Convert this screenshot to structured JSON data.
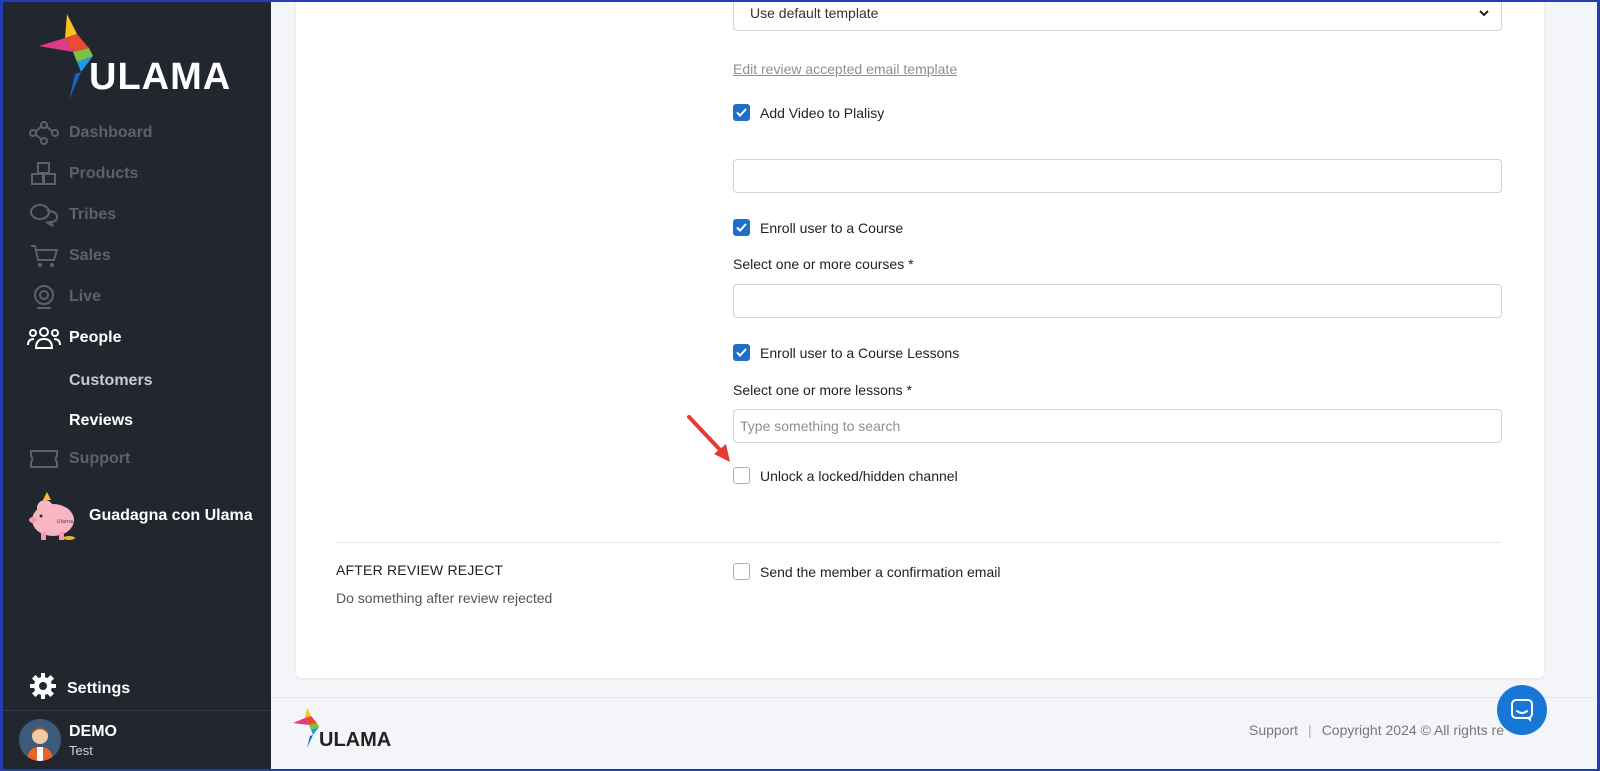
{
  "brand": {
    "name": "ULAMA"
  },
  "sidebar": {
    "items": [
      {
        "label": "Dashboard",
        "icon": "network-icon"
      },
      {
        "label": "Products",
        "icon": "boxes-icon"
      },
      {
        "label": "Tribes",
        "icon": "chat-bubbles-icon"
      },
      {
        "label": "Sales",
        "icon": "cart-icon"
      },
      {
        "label": "Live",
        "icon": "webcam-icon"
      },
      {
        "label": "People",
        "icon": "people-icon"
      },
      {
        "label": "Support",
        "icon": "ticket-icon"
      }
    ],
    "people_sub": [
      "Customers",
      "Reviews"
    ],
    "earn_label": "Guadagna con Ulama",
    "piggy_text": "Ulama",
    "settings_label": "Settings",
    "user": {
      "name": "DEMO",
      "role": "Test"
    }
  },
  "form": {
    "template_select": "Use default template",
    "edit_link": "Edit review accepted email template",
    "add_video_label": "Add Video to Plalisy",
    "add_video_value": "",
    "enroll_course_label": "Enroll user to a Course",
    "select_courses_label": "Select one or more courses *",
    "courses_value": "",
    "enroll_lessons_label": "Enroll user to a Course Lessons",
    "select_lessons_label": "Select one or more lessons *",
    "lessons_placeholder": "Type something to search",
    "unlock_channel_label": "Unlock a locked/hidden channel",
    "reject_section_title": "AFTER REVIEW REJECT",
    "reject_section_desc": "Do something after review rejected",
    "send_confirmation_label": "Send the member a confirmation email"
  },
  "footer": {
    "support": "Support",
    "separator": "|",
    "copyright": "Copyright 2024 © All rights re"
  },
  "colors": {
    "sidebar_bg": "#22262f",
    "accent": "#1f6fc9",
    "arrow": "#e53935",
    "chat": "#1877d6"
  }
}
